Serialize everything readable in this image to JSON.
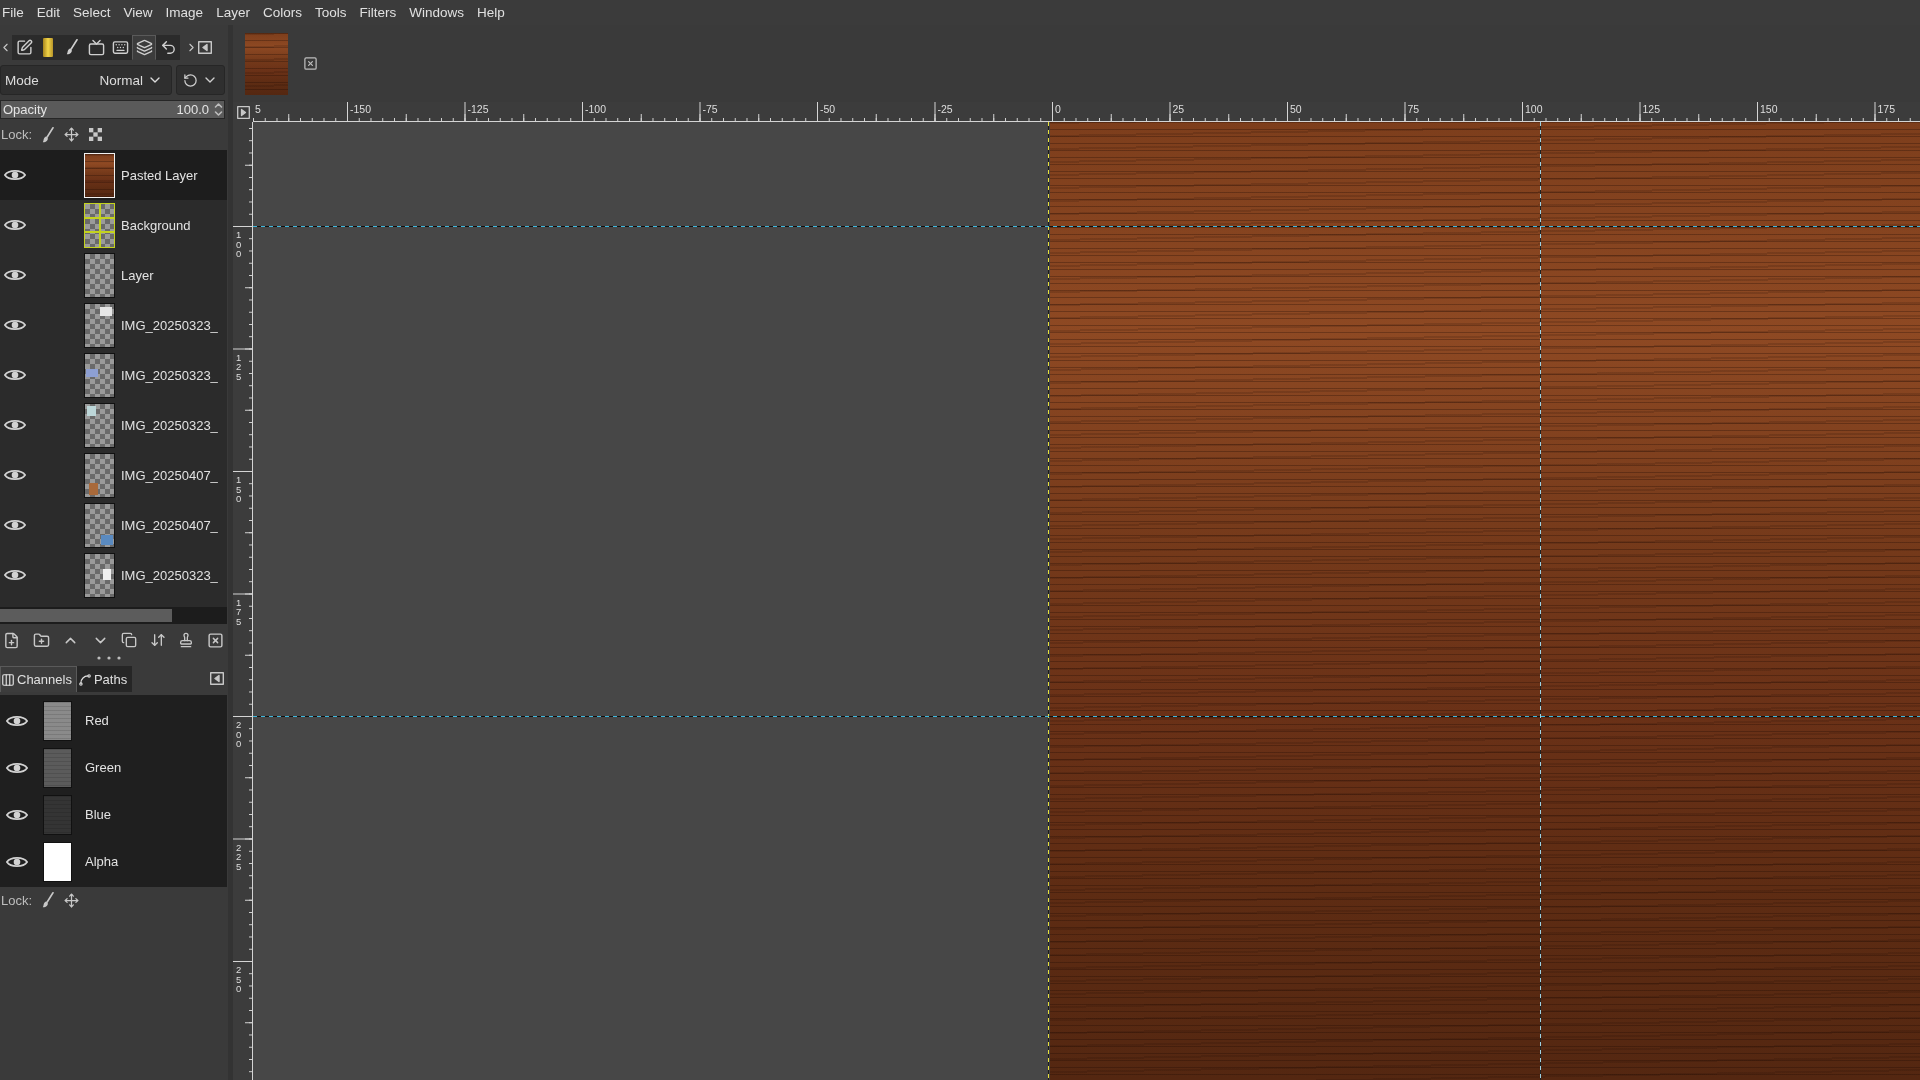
{
  "menu_bar": [
    "File",
    "Edit",
    "Select",
    "View",
    "Image",
    "Layer",
    "Colors",
    "Tools",
    "Filters",
    "Windows",
    "Help"
  ],
  "dock_tabs": [
    {
      "selected": false
    },
    {
      "selected": false
    },
    {
      "selected": false
    },
    {
      "selected": false
    },
    {
      "selected": false
    },
    {
      "selected": true
    },
    {
      "selected": false
    }
  ],
  "layers_panel": {
    "mode": {
      "label": "Mode",
      "value": "Normal"
    },
    "opacity": {
      "label": "Opacity",
      "value": "100.0",
      "level": 1
    },
    "lock_label": "Lock:",
    "layers": [
      {
        "name": "Pasted Layer",
        "kind": "wood",
        "visible": true,
        "selected": true
      },
      {
        "name": "Background",
        "kind": "grid",
        "visible": true,
        "selected": false
      },
      {
        "name": "Layer",
        "kind": "empty",
        "visible": true,
        "selected": false
      },
      {
        "name": "IMG_20250323_",
        "kind": "snippet",
        "visible": true,
        "selected": false
      },
      {
        "name": "IMG_20250323_",
        "kind": "snippet",
        "visible": true,
        "selected": false
      },
      {
        "name": "IMG_20250323_",
        "kind": "snippet",
        "visible": true,
        "selected": false
      },
      {
        "name": "IMG_20250407_",
        "kind": "snippet",
        "visible": true,
        "selected": false
      },
      {
        "name": "IMG_20250407_",
        "kind": "snippet",
        "visible": true,
        "selected": false
      },
      {
        "name": "IMG_20250323_",
        "kind": "snippet",
        "visible": true,
        "selected": false
      }
    ]
  },
  "channels_panel": {
    "tabs": [
      {
        "label": "Channels",
        "selected": true
      },
      {
        "label": "Paths",
        "selected": false
      }
    ],
    "channels": [
      {
        "name": "Red",
        "kind": "red",
        "visible": true
      },
      {
        "name": "Green",
        "kind": "green",
        "visible": true
      },
      {
        "name": "Blue",
        "kind": "blue",
        "visible": true
      },
      {
        "name": "Alpha",
        "kind": "alpha",
        "visible": true
      }
    ],
    "lock_label": "Lock:"
  },
  "rulers": {
    "horizontal": [
      "5",
      "-150",
      "-125",
      "-100",
      "-75",
      "-50",
      "-25",
      "0",
      "25",
      "50",
      "75",
      "100",
      "125",
      "150",
      "175"
    ],
    "vertical": [
      "100",
      "125",
      "150",
      "175",
      "200",
      "225",
      "250"
    ]
  }
}
